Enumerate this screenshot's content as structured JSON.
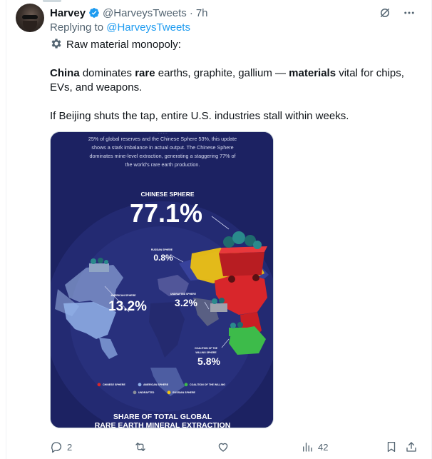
{
  "tweet": {
    "author_name": "Harvey",
    "author_handle": "@HarveysTweets",
    "separator": "·",
    "time": "7h",
    "reply_prefix": "Replying to",
    "reply_to": "@HarveysTweets",
    "line1": "Raw material monopoly:",
    "line2_a": "China",
    "line2_b": " dominates ",
    "line2_c": "rare",
    "line2_d": " earths, graphite, gallium — ",
    "line2_e": "materials",
    "line2_f": " vital for chips,",
    "line3": "EVs, and weapons.",
    "line4": "If Beijing shuts the tap, entire U.S. industries stall within weeks."
  },
  "infographic": {
    "intro_1": "25% of global reserves and the Chinese Sphere 53%, this update",
    "intro_2": "shows a stark imbalance in actual output. The Chinese Sphere",
    "intro_3": "dominates mine-level extraction, generating a staggering 77% of",
    "intro_4": "the world's rare earth production.",
    "chinese_label": "CHINESE SPHERE",
    "chinese_value": "77.1%",
    "russian_label": "RUSSIAN SPHERE",
    "russian_value": "0.8%",
    "american_label": "AMERICAN SPHERE",
    "american_value": "13.2%",
    "unaligned_label": "UNDRAFTED SPHERE",
    "unaligned_value": "3.2%",
    "coalition_label_1": "COALITION OF THE",
    "coalition_label_2": "WILLING SPHERE",
    "coalition_value": "5.8%",
    "legend": [
      {
        "label": "CHINESE SPHERE",
        "color": "#d8262b"
      },
      {
        "label": "AMERICAN SPHERE",
        "color": "#8fb0e8"
      },
      {
        "label": "COALITION OF THE WILLING",
        "color": "#3dbb4a"
      },
      {
        "label": "UNDRAFTED",
        "color": "#8a8f9a"
      },
      {
        "label": "RUSSIAN SPHERE",
        "color": "#f2c40f"
      }
    ],
    "footer_1": "SHARE OF TOTAL GLOBAL",
    "footer_2": "RARE EARTH MINERAL EXTRACTION"
  },
  "actions": {
    "reply_count": "2",
    "retweet_count": "",
    "like_count": "",
    "view_count": "42"
  },
  "colors": {
    "accent": "#1d9bf0",
    "muted": "#536471",
    "infographic_bg": "#1c2262"
  }
}
